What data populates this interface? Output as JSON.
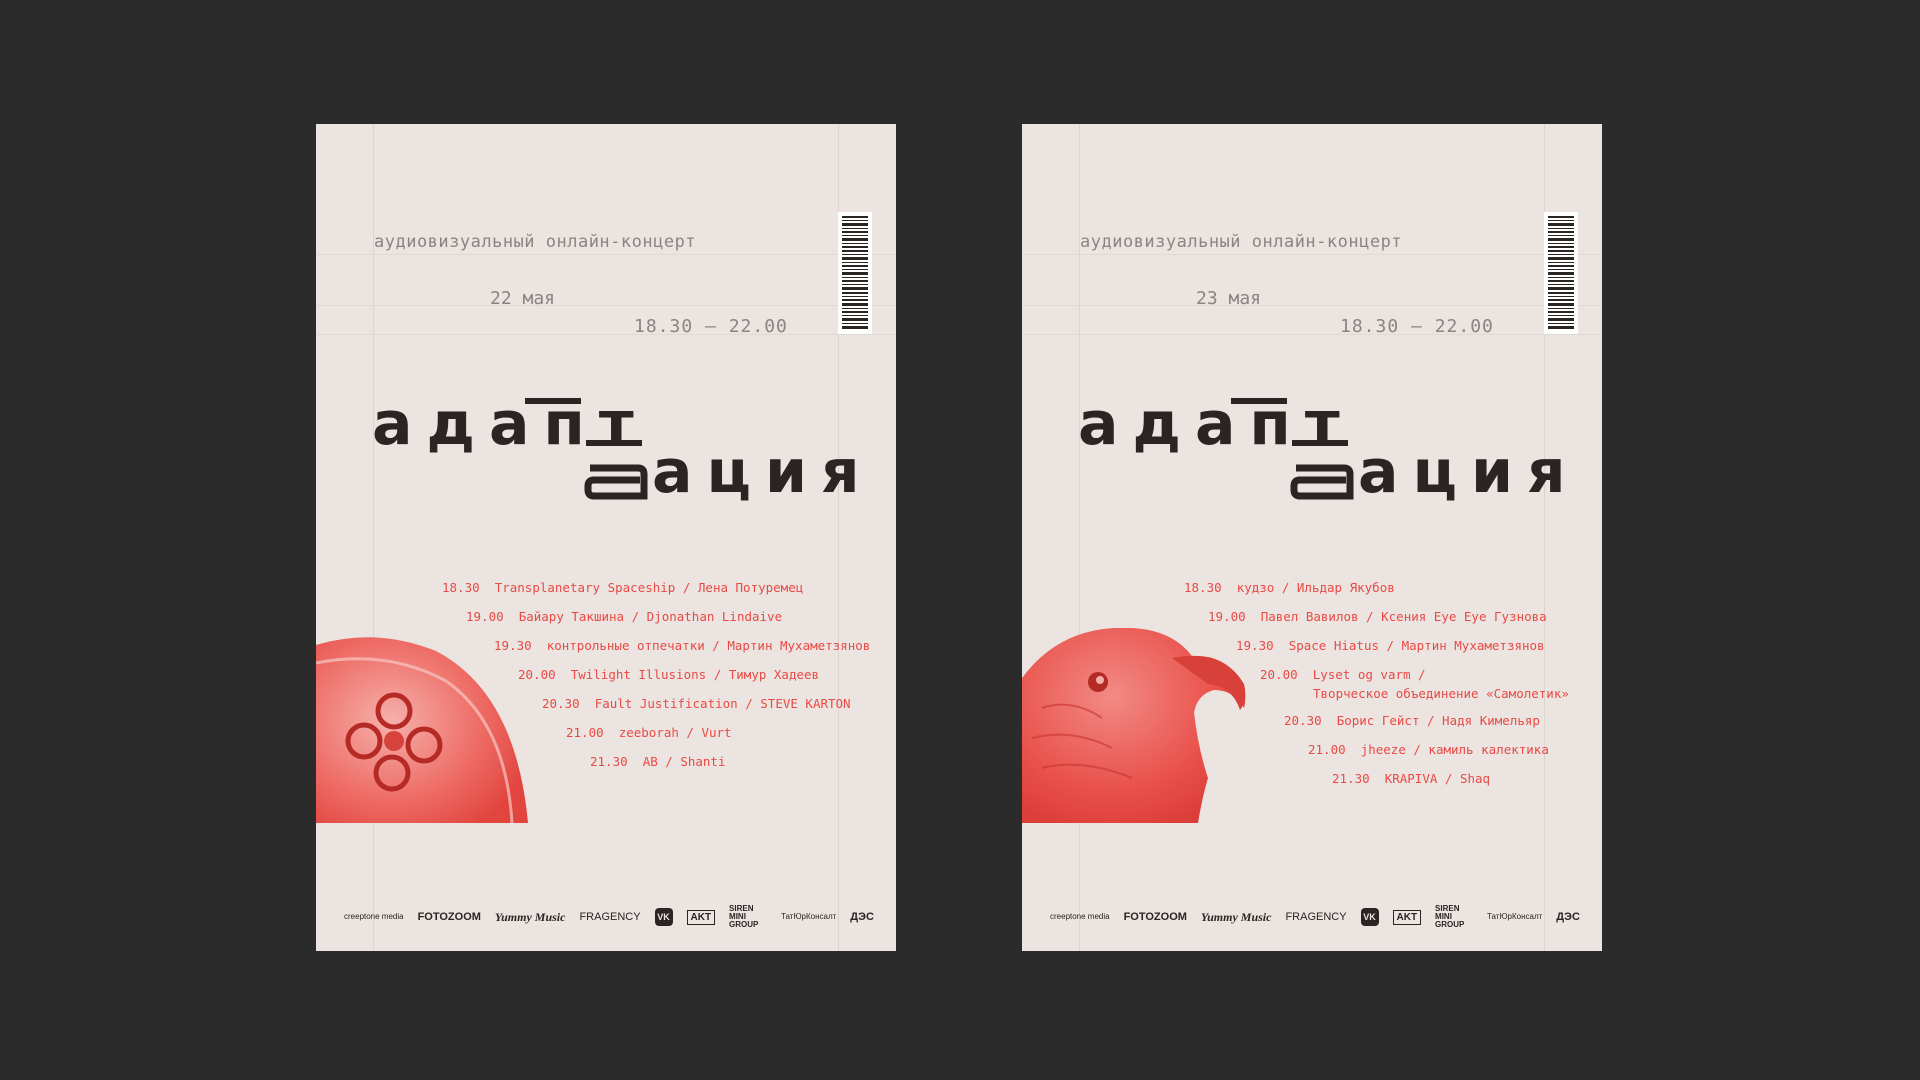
{
  "posters": [
    {
      "subtitle": "аудиовизуальный онлайн-концерт",
      "date": "22 мая",
      "time": "18.30 — 22.00",
      "title_line1": "адапт",
      "title_line2": "ация",
      "art": "jellyfish-illustration",
      "accent_color": "#ea4a45",
      "schedule": [
        {
          "time": "18.30",
          "text": "Transplanetary Spaceship / Лена Потуремец"
        },
        {
          "time": "19.00",
          "text": "Байару Такшина / Djonathan Lindaive"
        },
        {
          "time": "19.30",
          "text": "контрольные отпечатки / Мартин Мухаметзянов"
        },
        {
          "time": "20.00",
          "text": "Twilight Illusions / Тимур Хадеев"
        },
        {
          "time": "20.30",
          "text": "Fault Justification / STEVE KARTON"
        },
        {
          "time": "21.00",
          "text": "zeeborah / Vurt"
        },
        {
          "time": "21.30",
          "text": "AB / Shanti"
        }
      ]
    },
    {
      "subtitle": "аудиовизуальный онлайн-концерт",
      "date": "23 мая",
      "time": "18.30 — 22.00",
      "title_line1": "адапт",
      "title_line2": "ация",
      "art": "eagle-illustration",
      "accent_color": "#ea4a45",
      "schedule": [
        {
          "time": "18.30",
          "text": "кудзо / Ильдар Якубов"
        },
        {
          "time": "19.00",
          "text": "Павел Вавилов / Ксения Eye Eye Гузнова"
        },
        {
          "time": "19.30",
          "text": "Space Hiatus / Мартин Мухаметзянов"
        },
        {
          "time": "20.00",
          "text": "Lyset og varm /"
        },
        {
          "time": "",
          "text": "Творческое объединение «Самолетик»"
        },
        {
          "time": "20.30",
          "text": "Борис Гейст / Надя Кимельяр"
        },
        {
          "time": "21.00",
          "text": "jheeze / камиль калектика"
        },
        {
          "time": "21.30",
          "text": "KRAPIVA / Shaq"
        }
      ]
    }
  ],
  "logos": [
    "creeptone media",
    "FOTOZOOM",
    "Yummy Music",
    "FRAGENCY",
    "VK",
    "AKT",
    "SIREN MINI GROUP",
    "ТатЮрКонсалт",
    "ДЭС"
  ]
}
